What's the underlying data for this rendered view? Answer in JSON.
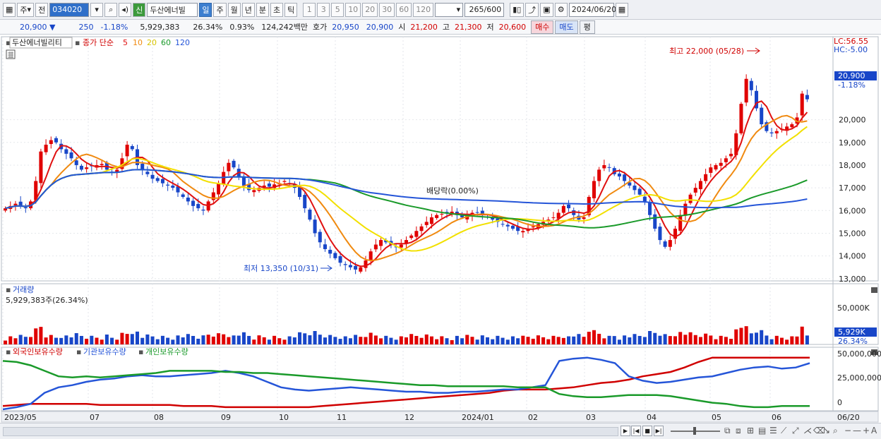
{
  "toolbar": {
    "market": "주",
    "prefix": "전",
    "code": "034020",
    "badge": "신",
    "stock_name": "두산에너빌",
    "periods": [
      "일",
      "주",
      "월",
      "년",
      "분",
      "초",
      "틱"
    ],
    "active_period": "일",
    "intervals": [
      "1",
      "3",
      "5",
      "10",
      "20",
      "30",
      "60",
      "120"
    ],
    "count": "265",
    "count_total": "/600",
    "date": "2024/06/20"
  },
  "quote": {
    "price": "20,900",
    "arrow": "▼",
    "change": "250",
    "change_pct": "-1.18%",
    "volume": "5,929,383",
    "turnover_pct": "26.34%",
    "ratio": "0.93%",
    "amount": "124,242백만",
    "hoga_label": "호가",
    "ask": "20,950",
    "bid": "20,900",
    "open_label": "시",
    "open": "21,200",
    "high_label": "고",
    "high": "21,300",
    "low_label": "저",
    "low": "20,600",
    "buy_label": "매수",
    "sell_label": "매도",
    "eval_label": "평"
  },
  "price_panel": {
    "name_label": "두산에너빌리티",
    "ma_label": "종가 단순",
    "ma_periods": [
      "5",
      "10",
      "20",
      "60",
      "120"
    ],
    "ma_colors": [
      "#e01010",
      "#f08a10",
      "#f2e000",
      "#1a9a2a",
      "#2555d8"
    ],
    "lc": "LC:56.55",
    "hc": "HC:-5.00",
    "current_price": "20,900",
    "current_pct": "-1.18%",
    "high_annotation": "최고 22,000 (05/28)",
    "low_annotation": "최저 13,350 (10/31)",
    "dividend_annotation": "배당락(0.00%)",
    "y_ticks": [
      "20,000",
      "19,000",
      "18,000",
      "17,000",
      "16,000",
      "15,000",
      "14,000",
      "13,000"
    ]
  },
  "volume_panel": {
    "title": "거래량",
    "value_label": "5,929,383주(26.34%)",
    "y_tick": "50,000K",
    "current": "5,929K",
    "current_pct": "26.34%"
  },
  "holdings_panel": {
    "legend": [
      {
        "label": "외국인보유수량",
        "color": "#d00000"
      },
      {
        "label": "기관보유수량",
        "color": "#2555d8"
      },
      {
        "label": "개인보유수량",
        "color": "#1a9a2a"
      }
    ],
    "y_ticks": [
      "50,000,000",
      "25,000,000",
      "0"
    ]
  },
  "x_axis": {
    "labels": [
      "2023/05",
      "07",
      "08",
      "09",
      "10",
      "11",
      "12",
      "2024/01",
      "02",
      "03",
      "04",
      "05",
      "06"
    ],
    "end_label": "06/20"
  },
  "chart_data": {
    "type": "candlestick",
    "period": "daily",
    "range": [
      "2023/05",
      "2024/06/20"
    ],
    "closes": [
      16100,
      16200,
      16300,
      16200,
      16100,
      16400,
      17300,
      18600,
      18900,
      19100,
      19000,
      18700,
      18500,
      18300,
      18000,
      17800,
      17900,
      17950,
      18000,
      18050,
      17800,
      17700,
      17800,
      18300,
      18900,
      18700,
      18000,
      17800,
      17600,
      17400,
      17300,
      17200,
      17100,
      17000,
      16800,
      16600,
      16400,
      16200,
      16100,
      16000,
      16400,
      16800,
      17200,
      17700,
      18100,
      17900,
      17500,
      17100,
      16900,
      16900,
      17000,
      17100,
      17050,
      17150,
      17200,
      17300,
      17200,
      17000,
      16600,
      16100,
      15600,
      15000,
      14600,
      14300,
      14100,
      13900,
      13700,
      13600,
      13500,
      13400,
      13500,
      13800,
      14200,
      14500,
      14700,
      14600,
      14500,
      14400,
      14500,
      14700,
      14900,
      15100,
      15300,
      15500,
      15700,
      15800,
      15850,
      15900,
      15950,
      15800,
      15700,
      15800,
      15900,
      15900,
      15800,
      15700,
      15600,
      15500,
      15400,
      15300,
      15200,
      15100,
      15100,
      15200,
      15300,
      15400,
      15500,
      15600,
      15700,
      15900,
      16200,
      16100,
      15800,
      15600,
      15700,
      16600,
      17300,
      17800,
      18000,
      17900,
      17600,
      17500,
      17300,
      17100,
      16900,
      16700,
      16400,
      15800,
      15200,
      14700,
      14400,
      14700,
      15200,
      15800,
      16300,
      16700,
      17000,
      17300,
      17600,
      17900,
      18000,
      18100,
      18300,
      18500,
      19400,
      20700,
      21800,
      21300,
      20500,
      19800,
      19500,
      19400,
      19500,
      19600,
      19700,
      19800,
      20100,
      21150,
      20900
    ],
    "last_close": 20900,
    "period_high": 22000,
    "period_high_date": "05/28",
    "period_low": 13350,
    "period_low_date": "10/31",
    "moving_averages": [
      5,
      10,
      20,
      60,
      120
    ],
    "y_range": [
      12900,
      22600
    ],
    "volume_ylim": [
      0,
      60000000
    ],
    "holdings": {
      "foreign": [
        3,
        4,
        5,
        5,
        5,
        5,
        5,
        4,
        4,
        4,
        4,
        4,
        4,
        3,
        3,
        3,
        2,
        2,
        2,
        2,
        2,
        2,
        2,
        3,
        4,
        5,
        6,
        7,
        8,
        9,
        10,
        11,
        12,
        13,
        14,
        15,
        17,
        18,
        18,
        18,
        19,
        20,
        22,
        24,
        25,
        27,
        30,
        32,
        34,
        38,
        43,
        47,
        47,
        47,
        47,
        47,
        47,
        47,
        47
      ],
      "institution": [
        0,
        2,
        5,
        15,
        20,
        22,
        25,
        27,
        28,
        30,
        31,
        30,
        30,
        31,
        32,
        33,
        35,
        33,
        30,
        25,
        20,
        18,
        17,
        18,
        19,
        20,
        19,
        18,
        17,
        16,
        16,
        15,
        15,
        16,
        16,
        17,
        18,
        18,
        20,
        22,
        44,
        46,
        47,
        45,
        42,
        30,
        26,
        24,
        25,
        27,
        29,
        30,
        33,
        36,
        38,
        39,
        37,
        38,
        42
      ],
      "individual": [
        44,
        43,
        40,
        35,
        30,
        29,
        30,
        29,
        30,
        31,
        32,
        33,
        35,
        35,
        35,
        35,
        34,
        34,
        33,
        33,
        32,
        31,
        30,
        29,
        28,
        27,
        26,
        25,
        24,
        23,
        22,
        22,
        21,
        21,
        21,
        21,
        21,
        20,
        20,
        20,
        14,
        12,
        11,
        11,
        12,
        13,
        13,
        13,
        12,
        10,
        8,
        6,
        5,
        3,
        2,
        2,
        3,
        3,
        3
      ],
      "unit": "백만주"
    }
  }
}
